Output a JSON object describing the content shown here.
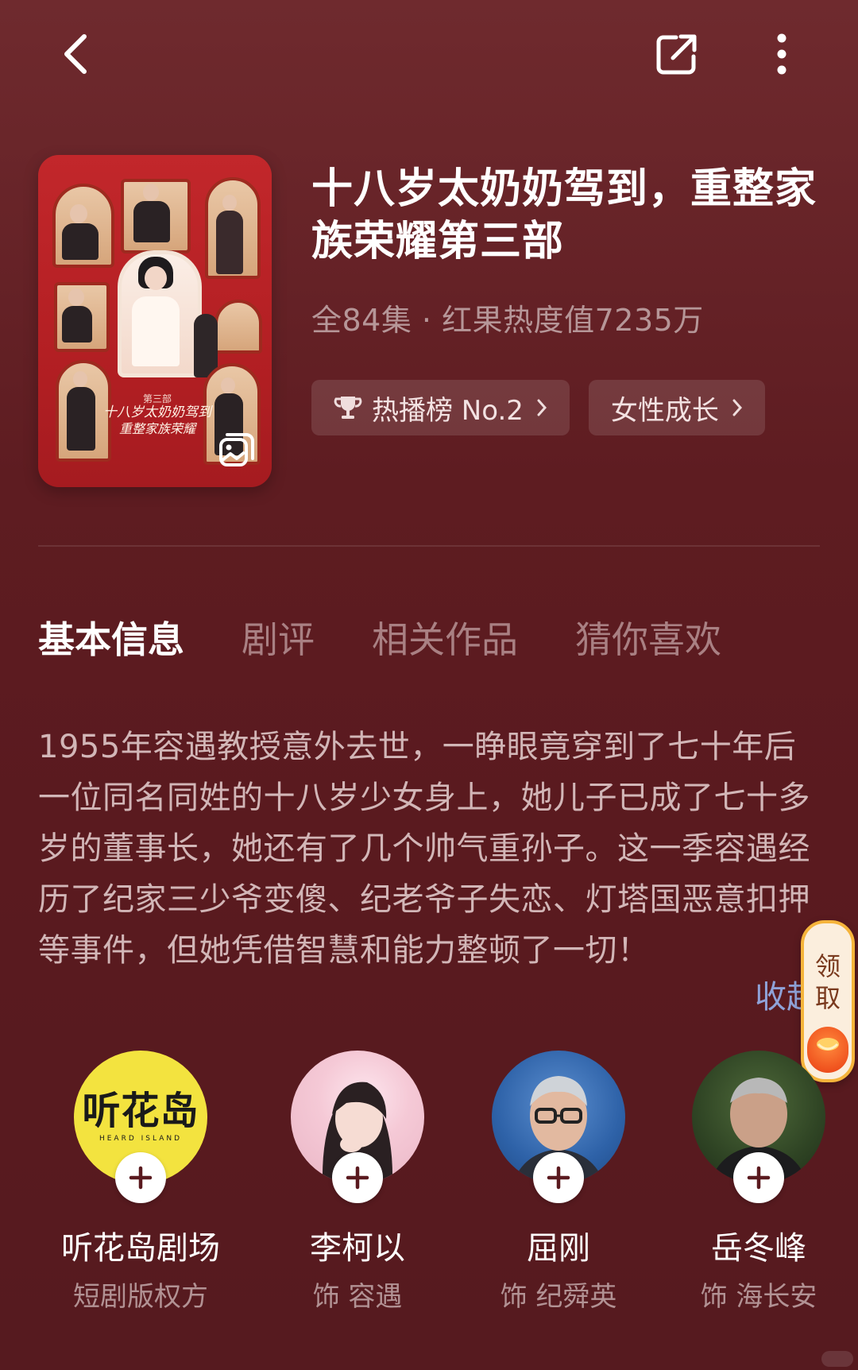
{
  "show": {
    "title": "十八岁太奶奶驾到，重整家族荣耀第三部",
    "meta": "全84集 · 红果热度值7235万",
    "poster": {
      "series_label": "第三部",
      "title_line1": "十八岁太奶奶驾到",
      "title_line2": "重整家族荣耀"
    },
    "tags": [
      {
        "label": "热播榜 No.2",
        "icon": "trophy-icon"
      },
      {
        "label": "女性成长",
        "icon": ""
      }
    ]
  },
  "tabs": [
    "基本信息",
    "剧评",
    "相关作品",
    "猜你喜欢"
  ],
  "active_tab": "基本信息",
  "synopsis": "1955年容遇教授意外去世，一睁眼竟穿到了七十年后一位同名同姓的十八岁少女身上，她儿子已成了七十多岁的董事长，她还有了几个帅气重孙子。这一季容遇经历了纪家三少爷变傻、纪老爷子失恋、灯塔国恶意扣押等事件，但她凭借智慧和能力整顿了一切！",
  "collapse_label": "收起",
  "reward": {
    "label": "领取"
  },
  "cast": [
    {
      "name": "听花岛剧场",
      "role": "短剧版权方",
      "logo_text": "听花岛",
      "logo_sub": "HEARD ISLAND"
    },
    {
      "name": "李柯以",
      "role": "饰 容遇"
    },
    {
      "name": "屈刚",
      "role": "饰 纪舜英"
    },
    {
      "name": "岳冬峰",
      "role": "饰 海长安"
    }
  ],
  "colors": {
    "background": "#5e1c21",
    "accent_link": "#8fa2d8",
    "logo_yellow": "#f3e33f"
  }
}
